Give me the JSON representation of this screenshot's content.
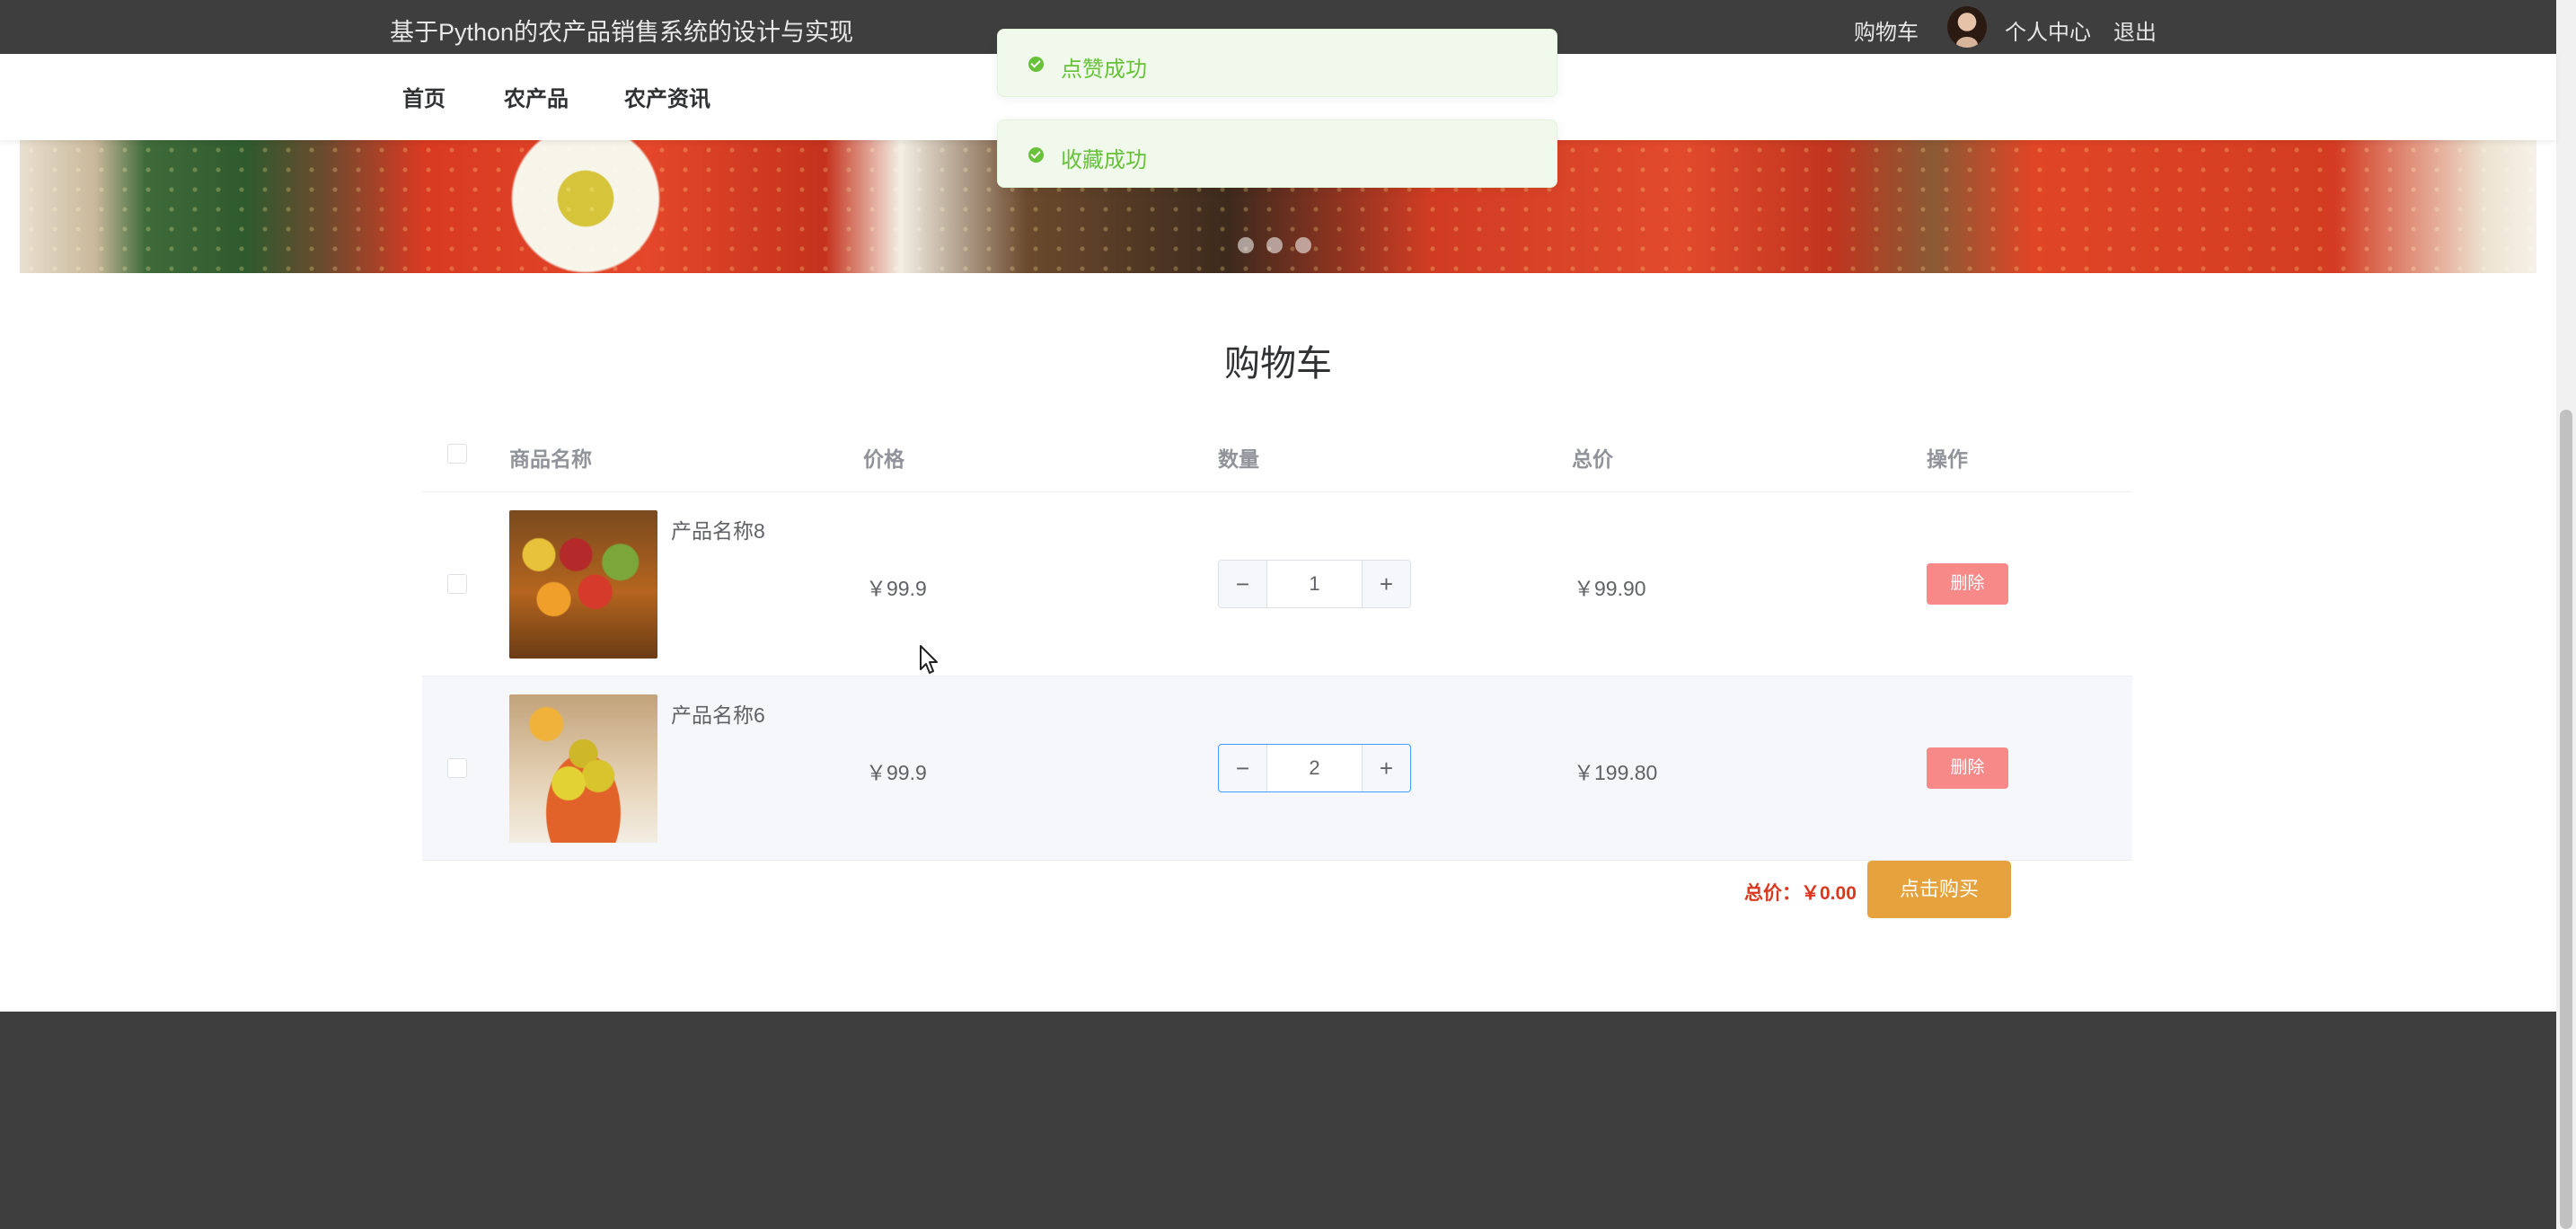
{
  "header": {
    "site_title": "基于Python的农产品销售系统的设计与实现",
    "cart_link": "购物车",
    "profile_link": "个人中心",
    "logout_link": "退出"
  },
  "nav": {
    "items": [
      {
        "label": "首页"
      },
      {
        "label": "农产品"
      },
      {
        "label": "农产资讯"
      }
    ]
  },
  "toasts": [
    {
      "message": "点赞成功",
      "type": "success"
    },
    {
      "message": "收藏成功",
      "type": "success"
    }
  ],
  "banner": {
    "slide_count": 3
  },
  "cart": {
    "title": "购物车",
    "columns": [
      "商品名称",
      "价格",
      "数量",
      "总价",
      "操作"
    ],
    "items": [
      {
        "name": "产品名称8",
        "price": "￥99.9",
        "quantity": "1",
        "subtotal": "￥99.90",
        "action": "删除",
        "minus": "−",
        "plus": "+"
      },
      {
        "name": "产品名称6",
        "price": "￥99.9",
        "quantity": "2",
        "subtotal": "￥199.80",
        "action": "删除",
        "minus": "−",
        "plus": "+"
      }
    ],
    "total_label": "总价：￥0.00",
    "buy_button": "点击购买"
  },
  "colors": {
    "header_bg": "#3e3e3e",
    "success": "#67c23a",
    "danger_button": "#f78989",
    "buy_button": "#e6a23c",
    "total_text": "#d9381e"
  }
}
